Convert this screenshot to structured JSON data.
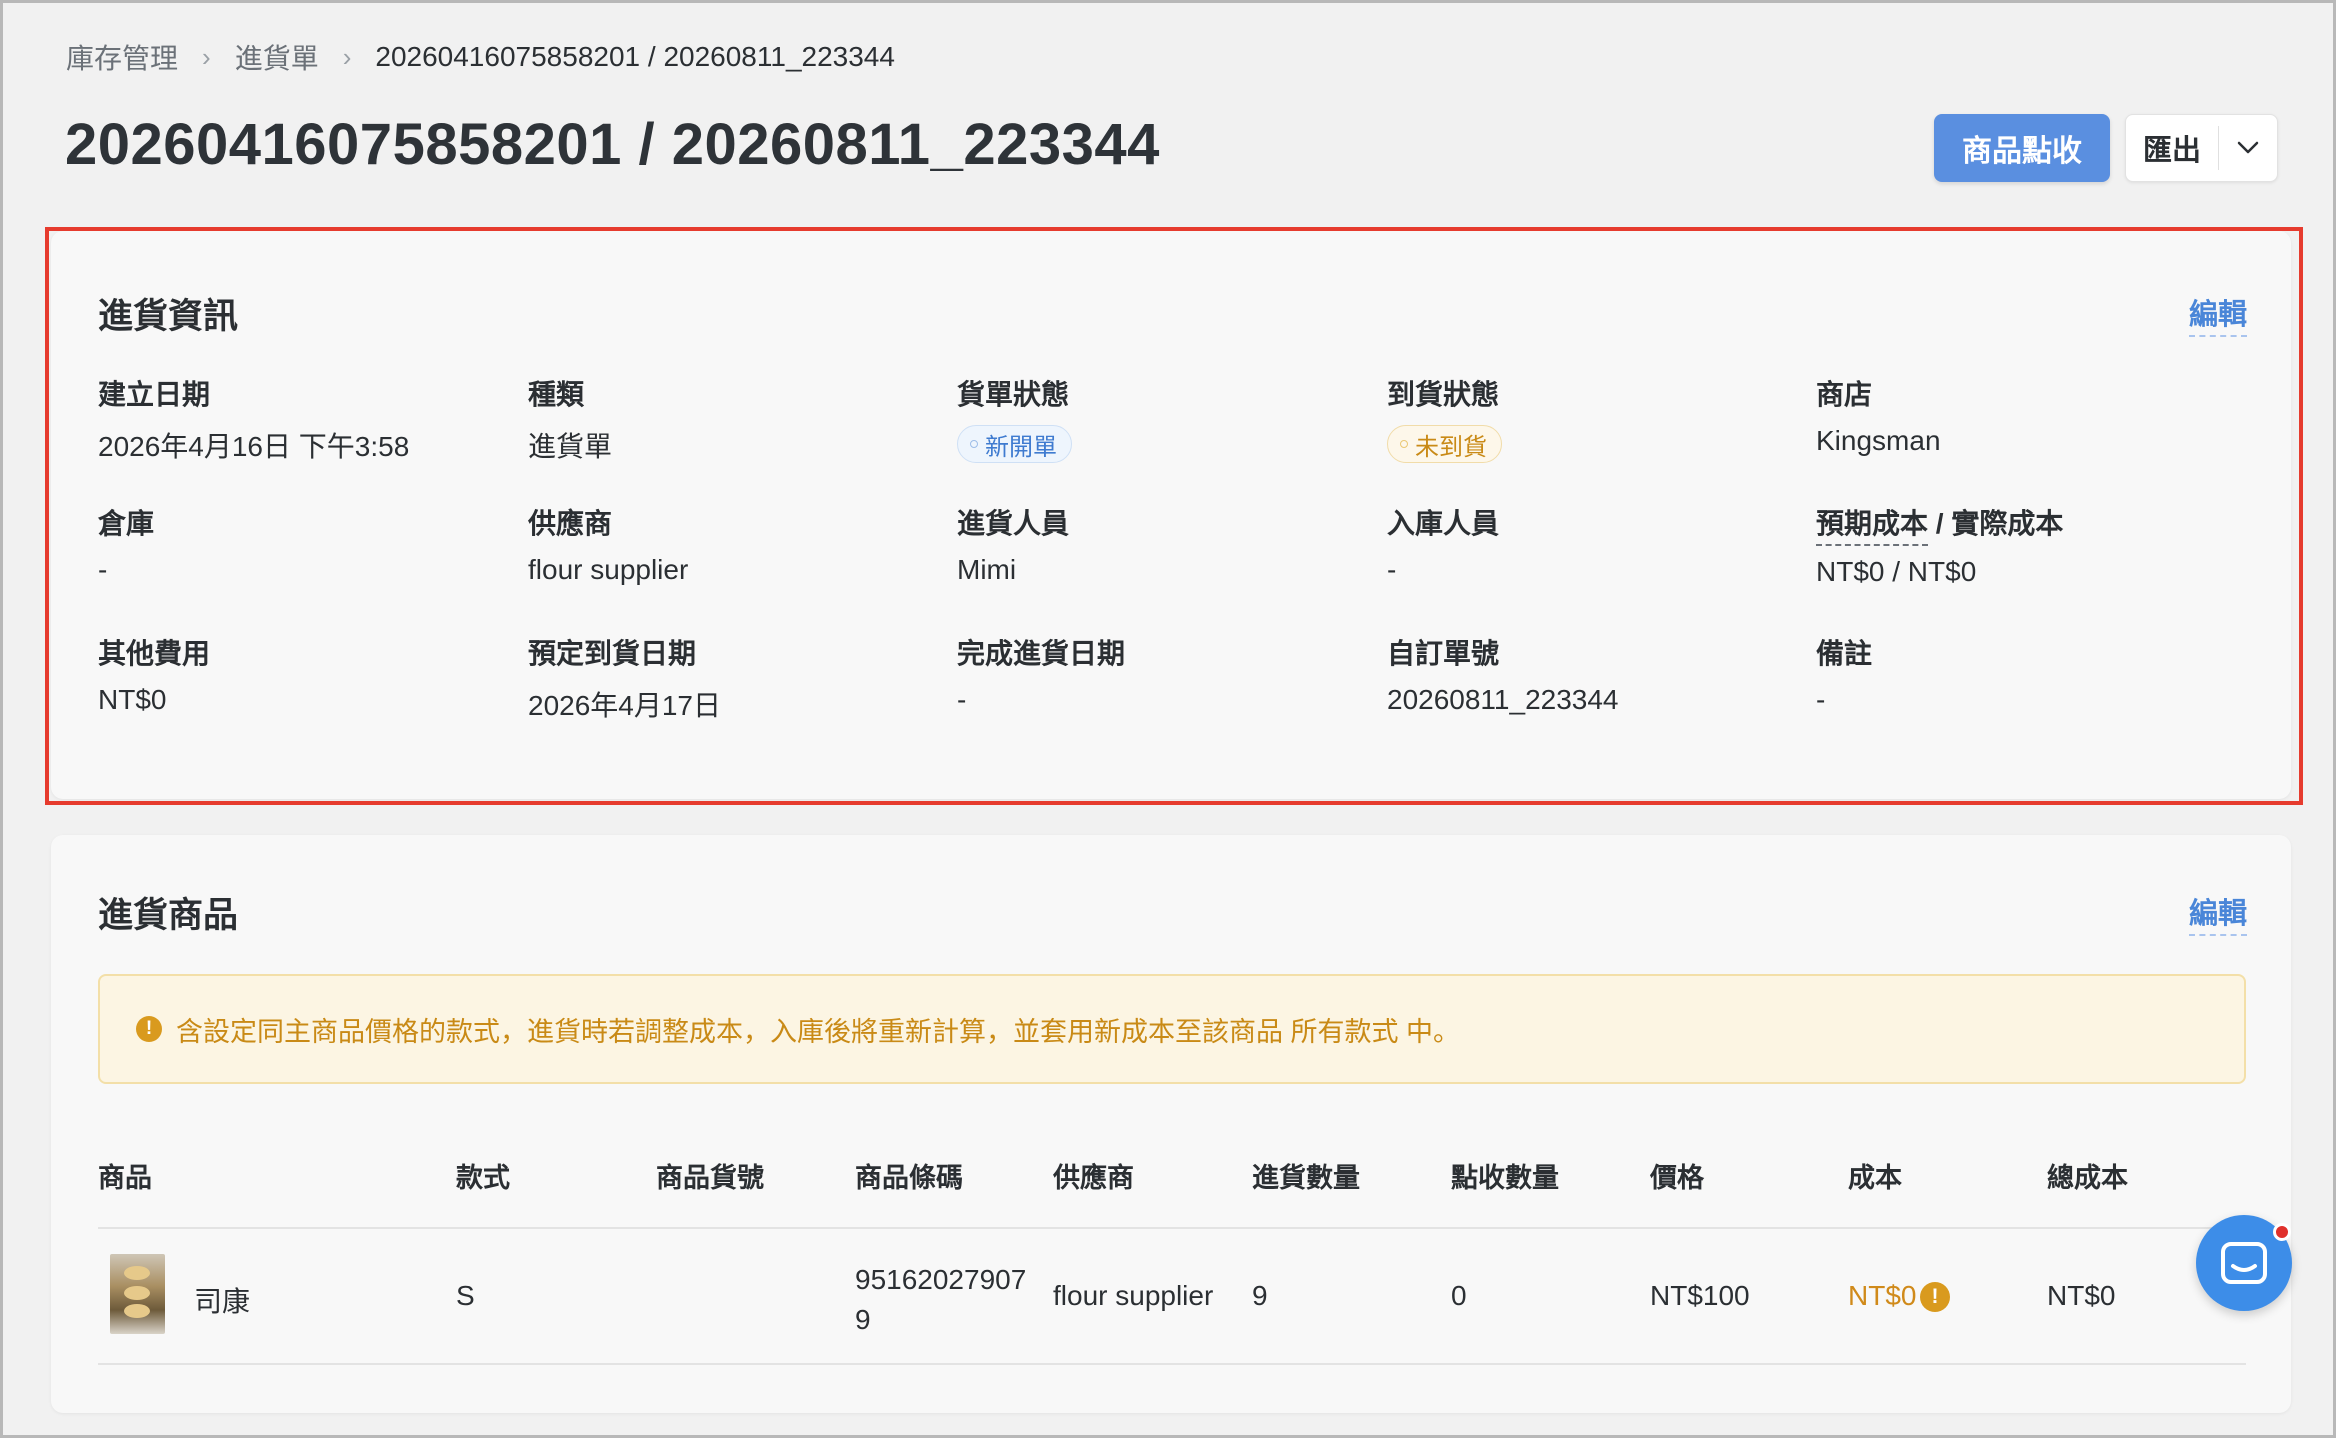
{
  "breadcrumb": {
    "items": [
      "庫存管理",
      "進貨單"
    ],
    "current": "20260416075858201 / 20260811_223344"
  },
  "page": {
    "title": "20260416075858201 / 20260811_223344",
    "primary_button": "商品點收",
    "export_button": "匯出"
  },
  "info": {
    "title": "進貨資訊",
    "edit": "編輯",
    "fields": {
      "created_date": {
        "label": "建立日期",
        "value": "2026年4月16日 下午3:58"
      },
      "type": {
        "label": "種類",
        "value": "進貨單"
      },
      "order_status": {
        "label": "貨單狀態",
        "value": "新開單"
      },
      "arrival_status": {
        "label": "到貨狀態",
        "value": "未到貨"
      },
      "store": {
        "label": "商店",
        "value": "Kingsman"
      },
      "warehouse": {
        "label": "倉庫",
        "value": "-"
      },
      "supplier": {
        "label": "供應商",
        "value": "flour supplier"
      },
      "purchaser": {
        "label": "進貨人員",
        "value": "Mimi"
      },
      "receiver": {
        "label": "入庫人員",
        "value": "-"
      },
      "cost": {
        "label": "預期成本 / 實際成本",
        "label_dashed": "預期成本",
        "label_rest": " / 實際成本",
        "value": "NT$0 / NT$0"
      },
      "other_fee": {
        "label": "其他費用",
        "value": "NT$0"
      },
      "expected_date": {
        "label": "預定到貨日期",
        "value": "2026年4月17日"
      },
      "completed_date": {
        "label": "完成進貨日期",
        "value": "-"
      },
      "custom_no": {
        "label": "自訂單號",
        "value": "20260811_223344"
      },
      "note": {
        "label": "備註",
        "value": "-"
      }
    }
  },
  "products": {
    "title": "進貨商品",
    "edit": "編輯",
    "notice": "含設定同主商品價格的款式，進貨時若調整成本，入庫後將重新計算，並套用新成本至該商品 所有款式 中。",
    "columns": [
      "商品",
      "款式",
      "商品貨號",
      "商品條碼",
      "供應商",
      "進貨數量",
      "點收數量",
      "價格",
      "成本",
      "總成本"
    ],
    "rows": [
      {
        "name": "司康",
        "variant": "S",
        "sku": "",
        "barcode_line1": "95162027907",
        "barcode_line2": "9",
        "supplier": "flour supplier",
        "qty": "9",
        "received": "0",
        "price": "NT$100",
        "cost": "NT$0",
        "total_cost": "NT$0"
      }
    ]
  },
  "colors": {
    "primary": "#5a8fe0",
    "link": "#4a86d8",
    "warning": "#c98a16",
    "highlight_border": "#e63b2e",
    "chat": "#3d8de8"
  },
  "icons": {
    "breadcrumb_separator": "chevron-right-icon",
    "export_caret": "chevron-down-icon",
    "notice": "warning-circle-icon",
    "cost_warning": "warning-circle-icon",
    "chat": "chat-icon"
  }
}
